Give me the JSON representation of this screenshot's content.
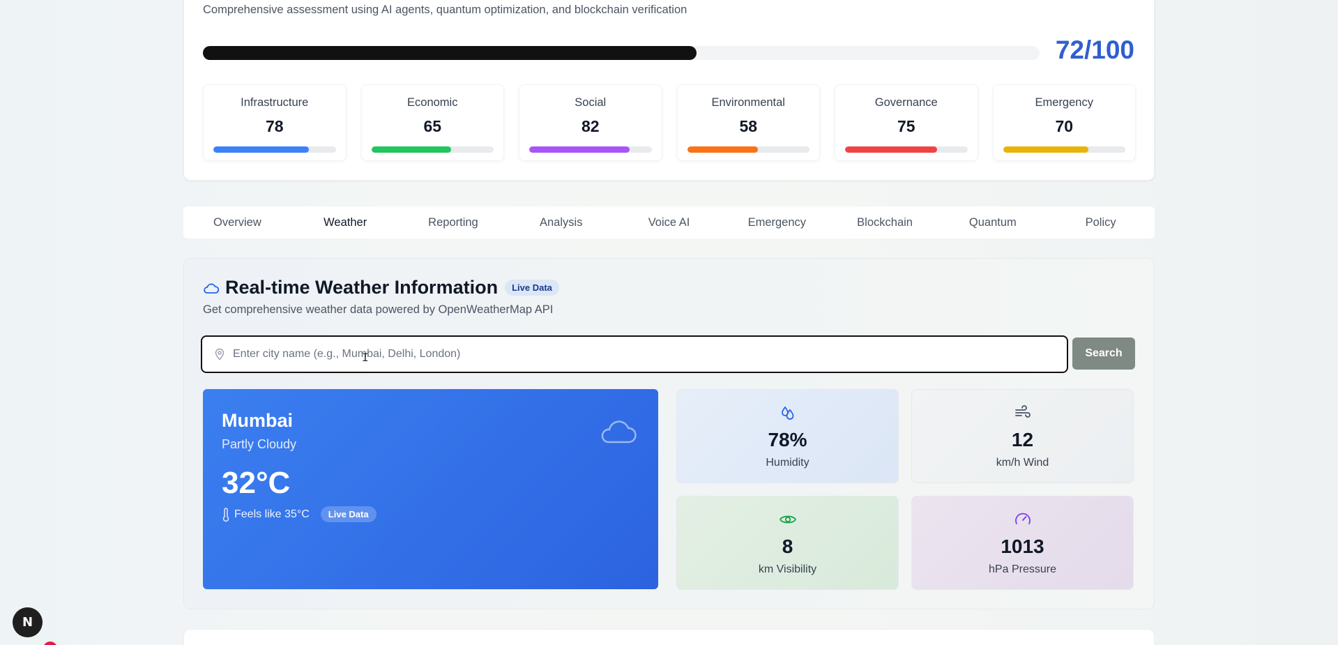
{
  "assessment": {
    "subtitle": "Comprehensive assessment using AI agents, quantum optimization, and blockchain verification",
    "overall_score": "72/100",
    "overall_progress": 0.59,
    "metrics": [
      {
        "label": "Infrastructure",
        "value": "78",
        "percent": 78,
        "color": "#3b82f6"
      },
      {
        "label": "Economic",
        "value": "65",
        "percent": 65,
        "color": "#22c55e"
      },
      {
        "label": "Social",
        "value": "82",
        "percent": 82,
        "color": "#a855f7"
      },
      {
        "label": "Environmental",
        "value": "58",
        "percent": 58,
        "color": "#f97316"
      },
      {
        "label": "Governance",
        "value": "75",
        "percent": 75,
        "color": "#ef4444"
      },
      {
        "label": "Emergency",
        "value": "70",
        "percent": 70,
        "color": "#eab308"
      }
    ]
  },
  "tabs": [
    {
      "label": "Overview",
      "active": false
    },
    {
      "label": "Weather",
      "active": true
    },
    {
      "label": "Reporting",
      "active": false
    },
    {
      "label": "Analysis",
      "active": false
    },
    {
      "label": "Voice AI",
      "active": false
    },
    {
      "label": "Emergency",
      "active": false
    },
    {
      "label": "Blockchain",
      "active": false
    },
    {
      "label": "Quantum",
      "active": false
    },
    {
      "label": "Policy",
      "active": false
    }
  ],
  "weather": {
    "title": "Real-time Weather Information",
    "badge": "Live Data",
    "description": "Get comprehensive weather data powered by OpenWeatherMap API",
    "search_placeholder": "Enter city name (e.g., Mumbai, Delhi, London)",
    "search_value": "",
    "search_button": "Search",
    "current": {
      "city": "Mumbai",
      "condition": "Partly Cloudy",
      "temperature": "32°C",
      "feels_like": "Feels like 35°C",
      "badge": "Live Data"
    },
    "stats": {
      "humidity": {
        "value": "78%",
        "label": "Humidity"
      },
      "wind": {
        "value": "12",
        "label": "km/h Wind"
      },
      "visibility": {
        "value": "8",
        "label": "km Visibility"
      },
      "pressure": {
        "value": "1013",
        "label": "hPa Pressure"
      }
    }
  },
  "colors": {
    "accent_score": "#2f5fd0",
    "weather_card": "#2f6ee6",
    "humidity_icon": "#2563eb",
    "wind_icon": "#475569",
    "visibility_icon": "#16a34a",
    "pressure_icon": "#7c3aed"
  },
  "icons": {
    "title_icon": "cloud-icon",
    "search_icon": "map-pin-icon",
    "weather_icon": "cloud-icon",
    "feels_icon": "thermometer-icon",
    "humidity_icon": "droplets-icon",
    "wind_icon": "wind-icon",
    "visibility_icon": "eye-icon",
    "pressure_icon": "gauge-icon"
  },
  "dev_badge": "N"
}
